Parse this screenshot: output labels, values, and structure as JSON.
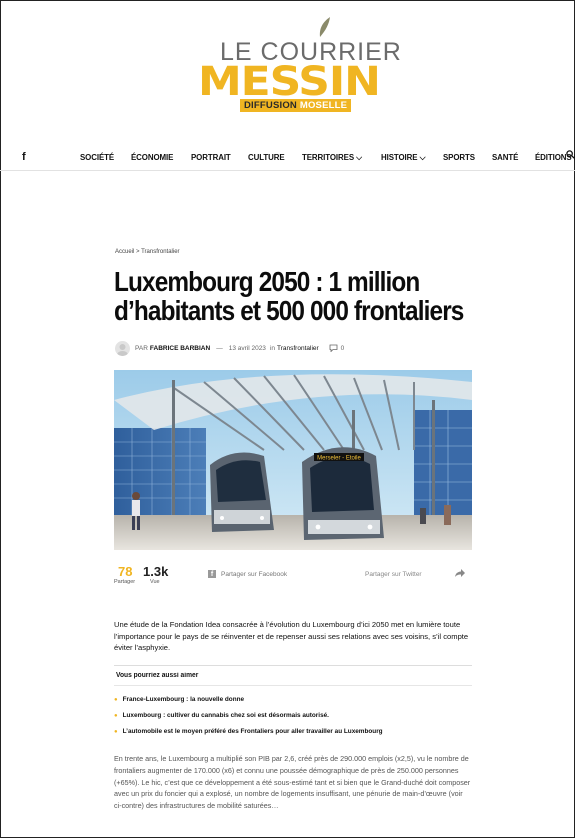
{
  "brand": {
    "line1": "LE COURRIER",
    "line2": "MESSIN",
    "tag_prefix": "DIFFUSION",
    "tag_suffix": "MOSELLE",
    "accent": "#f0b522"
  },
  "nav": {
    "facebook_icon": "f",
    "items": [
      "SOCIÉTÉ",
      "ÉCONOMIE",
      "PORTRAIT",
      "CULTURE",
      "TERRITOIRES ⌵",
      "HISTOIRE ⌵",
      "SPORTS",
      "SANTÉ",
      "ÉDITIONS EN PDF"
    ],
    "search_icon": "search-icon"
  },
  "breadcrumb": {
    "home": "Accueil",
    "sep": ">",
    "current": "Transfrontalier"
  },
  "article": {
    "title": "Luxembourg 2050 : 1 million d’habitants et 500 000 frontaliers",
    "by": "PAR",
    "author": "FABRICE BARBIAN",
    "dash": "—",
    "date": "13 avril 2023",
    "in": "in",
    "category": "Transfrontalier",
    "comments": "0",
    "lead": "Une étude de la Fondation Idea consacrée à l’évolution du Luxembourg d’ici 2050 met en lumière toute l’importance pour le pays de se réinventer et de repenser aussi ses relations avec ses voisins, s’il compte éviter l’asphyxie.",
    "body": "En trente ans, le Luxembourg a multiplié son PIB par 2,6, créé près de 290.000 emplois (x2,5), vu le nombre de frontaliers augmenter de 170.000 (x6) et connu une poussée démographique de près de 250.000 personnes (+65%). Le hic, c’est que ce développement a été sous-estimé tant et si bien que le Grand-duché doit composer avec un prix du foncier qui a explosé, un nombre de logements insuffisant, une pénurie de main-d’œuvre (voir ci-contre) des infrastructures de mobilité saturées…"
  },
  "photo": {
    "tram_sign": "Merseler - Etoile"
  },
  "share": {
    "shares_count": "78",
    "shares_label": "Partager",
    "views_count": "1.3k",
    "views_label": "Vue",
    "facebook_label": "Partager sur Facebook",
    "twitter_label": "Partager sur Twitter"
  },
  "related": {
    "heading": "Vous pourriez aussi aimer",
    "items": [
      "France-Luxembourg : la nouvelle donne",
      "Luxembourg : cultiver du cannabis chez soi est désormais autorisé.",
      "L’automobile est le moyen préféré des Frontaliers pour aller travailler au Luxembourg"
    ]
  }
}
